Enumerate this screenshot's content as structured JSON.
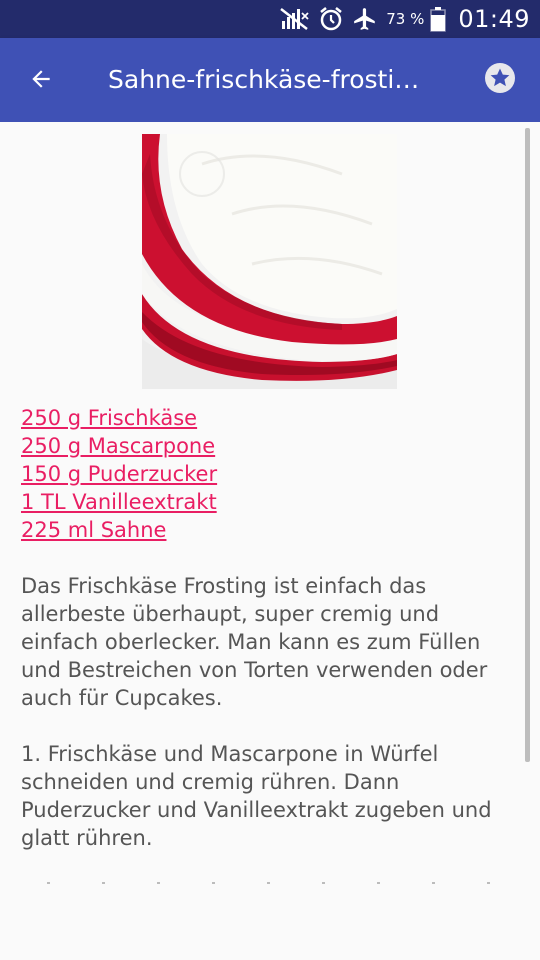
{
  "status_bar": {
    "battery_percent": "73 %",
    "time": "01:49",
    "icons": [
      "mute-icon",
      "alarm-icon",
      "airplane-mode-icon",
      "battery-icon"
    ]
  },
  "app_bar": {
    "title": "Sahne-frischkäse-frosti…",
    "back_icon": "arrow-back-icon",
    "favorite_icon": "star-icon"
  },
  "recipe": {
    "ingredients": [
      "250 g Frischkäse",
      "250 g Mascarpone",
      "150 g Puderzucker",
      "1 TL Vanilleextrakt",
      "225 ml Sahne"
    ],
    "description": "Das Frischkäse Frosting ist einfach das allerbeste überhaupt, super cremig und einfach oberlecker. Man kann es zum Füllen und Bestreichen von Torten verwenden oder auch für Cupcakes.",
    "steps": [
      "1. Frischkäse und Mascarpone in Würfel schneiden und cremig rühren. Dann Puderzucker und Vanilleextrakt zugeben und glatt rühren."
    ]
  },
  "colors": {
    "status_bar": "#232b6b",
    "app_bar": "#3f51b5",
    "link": "#e91e63",
    "body_text": "#555555"
  }
}
